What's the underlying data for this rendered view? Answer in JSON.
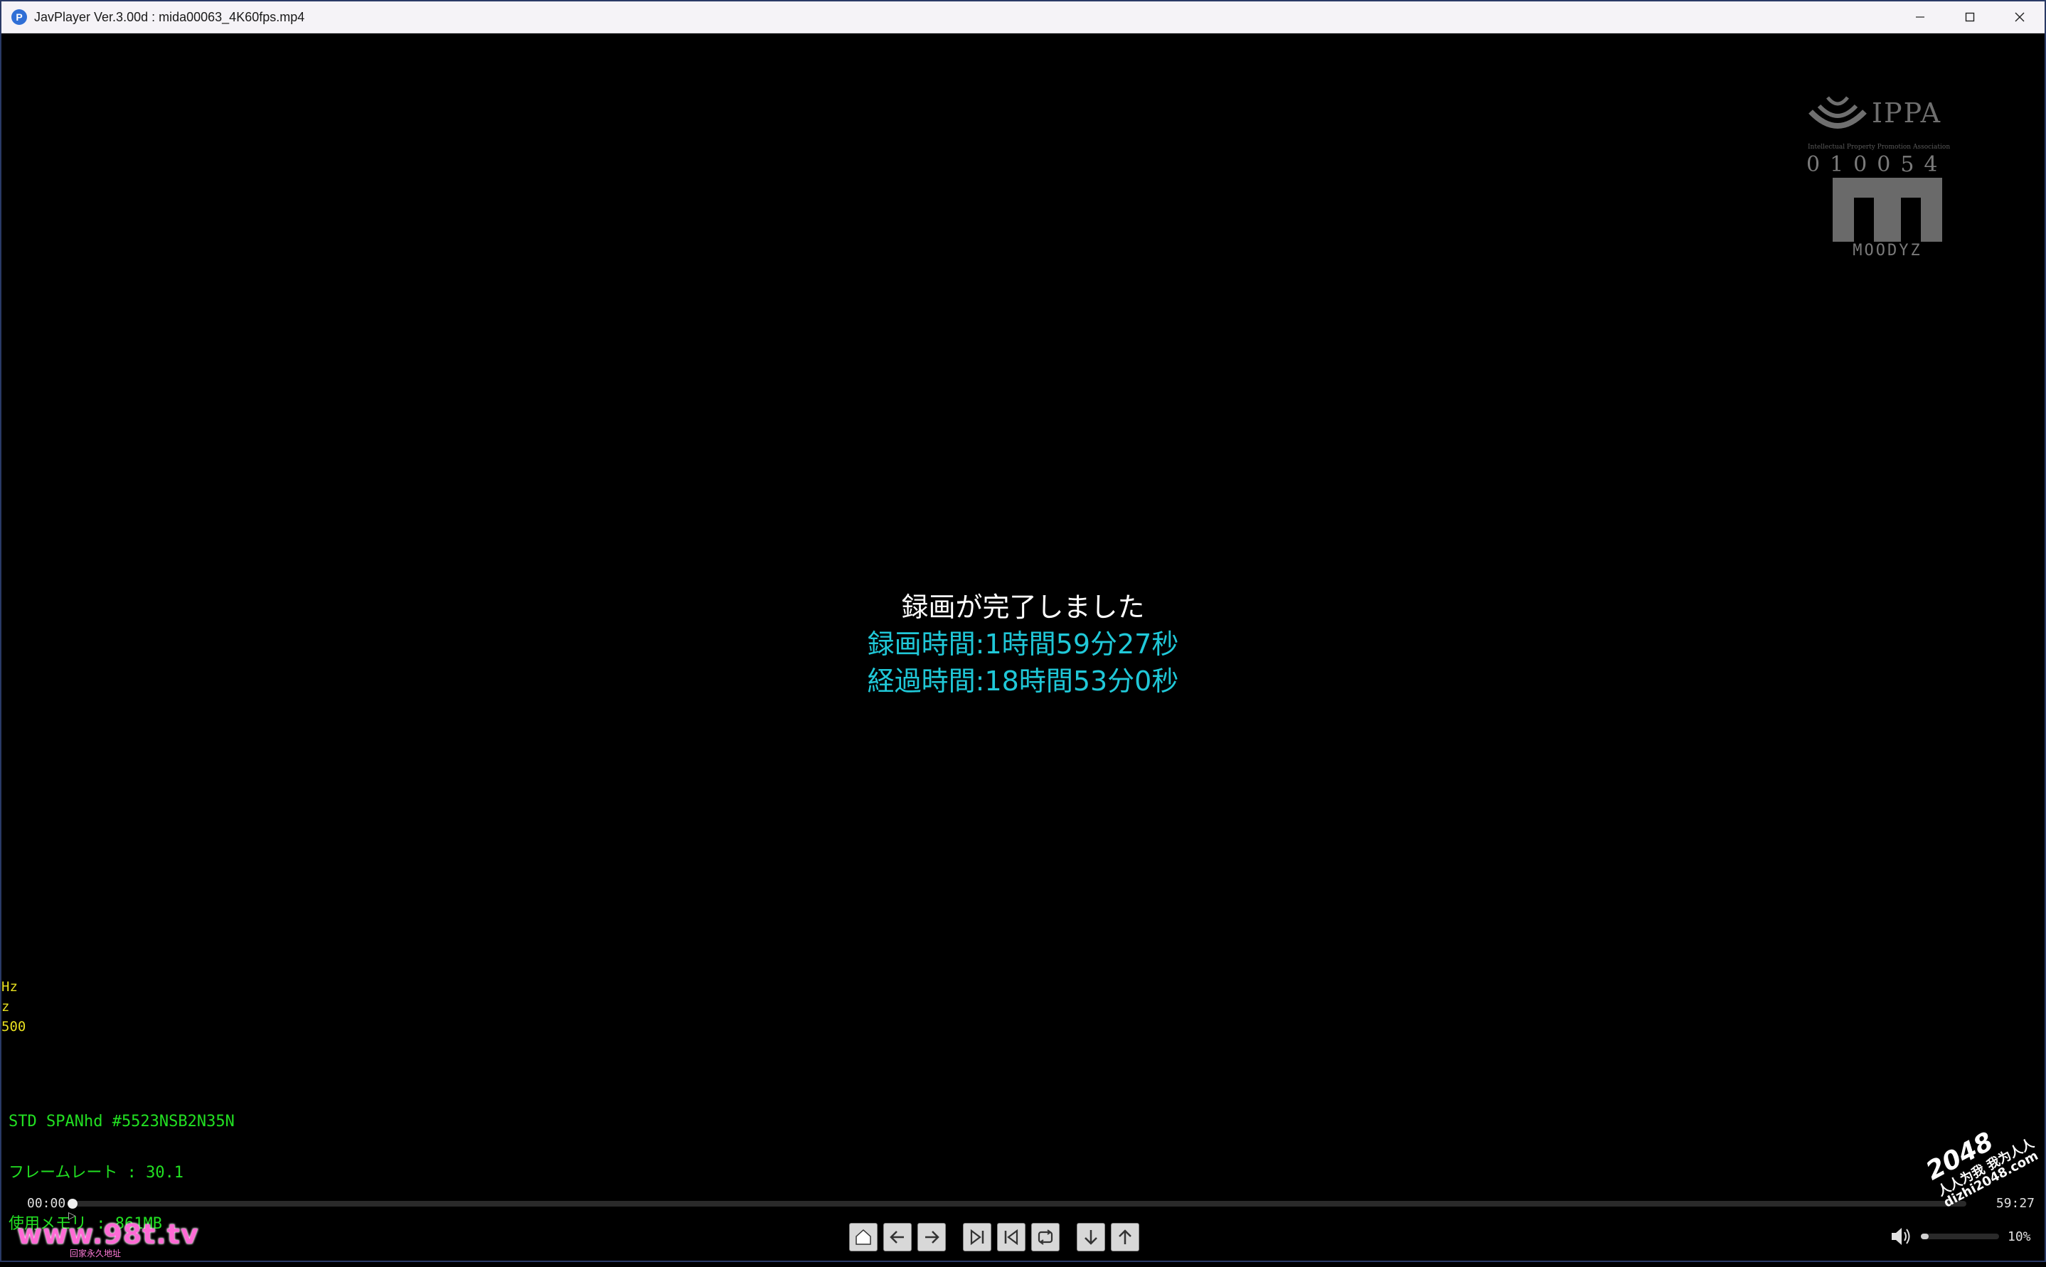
{
  "window": {
    "app_icon_glyph": "P",
    "title": "JavPlayer Ver.3.00d : mida00063_4K60fps.mp4"
  },
  "logo": {
    "ippa": "IPPA",
    "ippa_sub": "Intellectual Property Promotion Association",
    "code": "010054",
    "brand": "MOODYZ"
  },
  "message": {
    "line1": "録画が完了しました",
    "line2": "録画時間:1時間59分27秒",
    "line3": "経過時間:18時間53分0秒"
  },
  "yellow_info": [
    "Hz",
    "z",
    "500"
  ],
  "green_info": {
    "line1": "STD SPANhd #5523NSB2N35N",
    "line2": "フレームレート : 30.1",
    "line3": "使用メモリ : 861MB"
  },
  "seek": {
    "current_time": "00:00",
    "total_time": "59:27",
    "progress": 0.0
  },
  "controls": [
    {
      "name": "home-button",
      "icon": "home-icon"
    },
    {
      "name": "prev-button",
      "icon": "arrow-left-icon"
    },
    {
      "name": "next-button",
      "icon": "arrow-right-icon"
    },
    {
      "name": "skip-end-button",
      "icon": "skip-forward-icon"
    },
    {
      "name": "skip-start-button",
      "icon": "skip-back-icon"
    },
    {
      "name": "repeat-button",
      "icon": "repeat-icon"
    },
    {
      "name": "down-button",
      "icon": "arrow-down-icon"
    },
    {
      "name": "up-button",
      "icon": "arrow-up-icon"
    }
  ],
  "volume": {
    "percent_label": "10%",
    "level": 0.1
  },
  "watermarks": {
    "left_text": "www.98t.tv",
    "left_sub": "回家永久地址",
    "right_big": "2048",
    "right_line1": "人人为我 我为人人",
    "right_line2": "dizhi2048.com"
  },
  "colors": {
    "message_white": "#ffffff",
    "message_cyan": "#20c8d8",
    "info_green": "#22e022",
    "info_yellow": "#e8e020"
  }
}
